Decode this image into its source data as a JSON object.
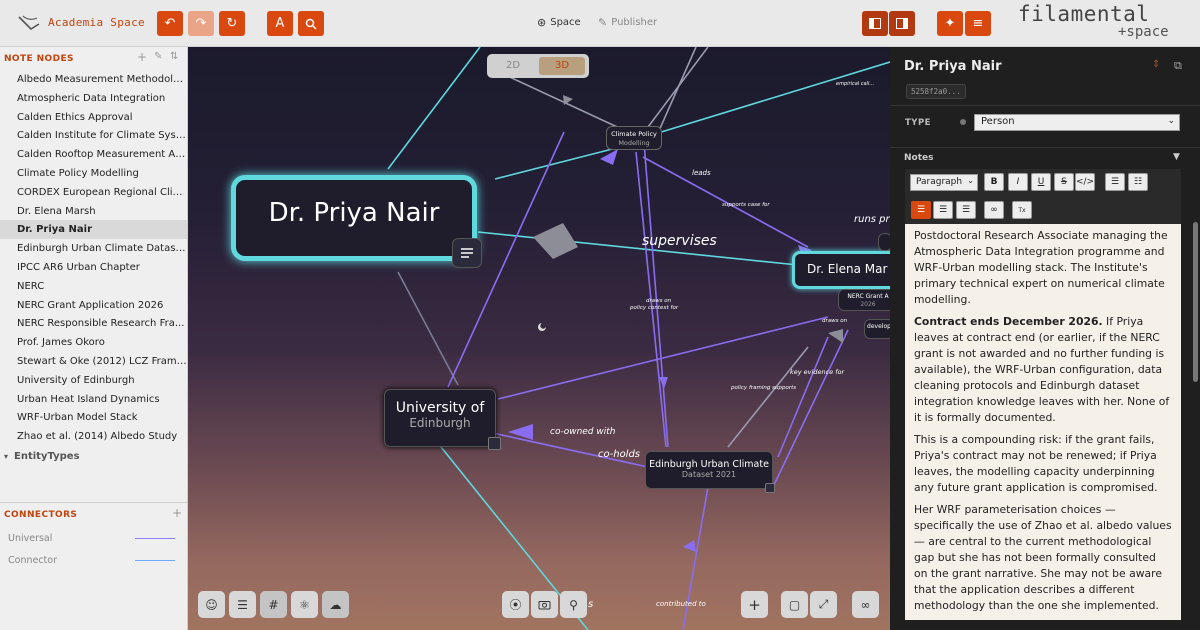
{
  "app": {
    "title": "Academia Space",
    "brand": "filamental",
    "brand_sub": "+space"
  },
  "header": {
    "tabs": [
      {
        "label": "Space",
        "icon": "space-icon"
      },
      {
        "label": "Publisher",
        "icon": "pen-icon"
      }
    ]
  },
  "sidebar": {
    "nodes_title": "NOTE NODES",
    "items": [
      "Albedo Measurement Methodolo...",
      "Atmospheric Data Integration",
      "Calden Ethics Approval",
      "Calden Institute for Climate Syst...",
      "Calden Rooftop Measurement Ar...",
      "Climate Policy Modelling",
      "CORDEX European Regional Clim...",
      "Dr. Elena Marsh",
      "Dr. Priya Nair",
      "Edinburgh Urban Climate Datase...",
      "IPCC AR6 Urban Chapter",
      "NERC",
      "NERC Grant Application 2026",
      "NERC Responsible Research Fra...",
      "Prof. James Okoro",
      "Stewart & Oke (2012) LCZ Frame...",
      "University of Edinburgh",
      "Urban Heat Island Dynamics",
      "WRF-Urban Model Stack",
      "Zhao et al. (2014) Albedo Study"
    ],
    "entity_types": "EntityTypes",
    "connectors_title": "CONNECTORS",
    "connectors": [
      {
        "label": "Universal",
        "color": "#8c7cff"
      },
      {
        "label": "Connector",
        "color": "#6fa8ff"
      }
    ]
  },
  "canvas": {
    "toggle": {
      "two_d": "2D",
      "three_d": "3D"
    },
    "nodes": {
      "priya": "Dr. Priya Nair",
      "elena": "Dr. Elena Mar",
      "uoe_line1": "University of",
      "uoe_line2": "Edinburgh",
      "eucd_line1": "Edinburgh Urban Climate",
      "eucd_line2": "Dataset 2021",
      "cpm_line1": "Climate Policy",
      "cpm_line2": "Modelling",
      "nerc_line1": "NERC Grant A",
      "nerc_line2": "2026",
      "develop": "develop",
      "cordex": "Cordex Re..."
    },
    "edges": {
      "supervises": "supervises",
      "runs_pr": "runs pr",
      "co_owned_with": "co-owned with",
      "co_holds": "co-holds",
      "leads": "leads",
      "supports_case_for": "supports case for",
      "draws_on_policy": "draws on",
      "draws_on_policy2": "policy context for",
      "draws_on": "draws on",
      "key_evidence_for": "key evidence for",
      "policy_framing_supports": "policy framing supports",
      "contributed_to": "contributed to",
      "empirical": "empirical cali...",
      "s": "s"
    }
  },
  "panel": {
    "title": "Dr. Priya Nair",
    "id": "5258f2a0...",
    "type_label": "TYPE",
    "type_value": "Person",
    "notes_label": "Notes",
    "format_select": "Paragraph",
    "notes": {
      "p1": "Postdoctoral Research Associate managing the Atmospheric Data Integration programme and WRF-Urban modelling stack. The Institute's primary technical expert on numerical climate modelling.",
      "p2_bold": "Contract ends December 2026.",
      "p2_rest": " If Priya leaves at contract end (or earlier, if the NERC grant is not awarded and no further funding is available), the WRF-Urban configuration, data cleaning protocols and Edinburgh dataset integration knowledge leaves with her. None of it is formally documented.",
      "p3": "This is a compounding risk: if the grant fails, Priya's contract may not be renewed; if Priya leaves, the modelling capacity underpinning any future grant application is compromised.",
      "p4": "Her WRF parameterisation choices — specifically the use of Zhao et al. albedo values — are central to the current methodological gap but she has not been formally consulted on the grant narrative. She may not be aware that the application describes a different methodology than the one she implemented."
    }
  },
  "colors": {
    "accent": "#d9480f",
    "canvas_edge_cyan": "#5fd8de",
    "canvas_edge_violet": "#8a6cf0"
  }
}
